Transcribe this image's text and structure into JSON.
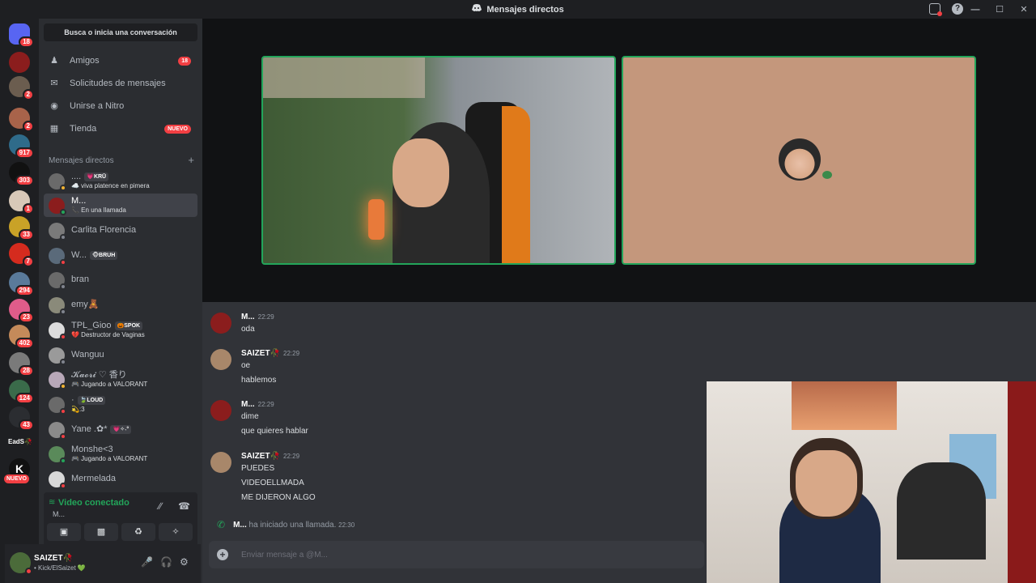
{
  "window": {
    "title": "Mensajes directos"
  },
  "rail": {
    "servers": [
      {
        "badge": "18",
        "color": "#5865f2"
      },
      {
        "badge": "",
        "color": "#8b1d1d"
      },
      {
        "badge": "2",
        "color": "#6b5d4f"
      },
      {
        "badge": "2",
        "color": "#a8634a"
      },
      {
        "badge": "917",
        "color": "#2f6b8a"
      },
      {
        "badge": "303",
        "color": "#111111"
      },
      {
        "badge": "1",
        "color": "#d8c8b8"
      },
      {
        "badge": "33",
        "color": "#c9a227"
      },
      {
        "badge": "7",
        "color": "#d52b1e"
      },
      {
        "badge": "294",
        "color": "#5a7a9a"
      },
      {
        "badge": "23",
        "color": "#e05c8a"
      },
      {
        "badge": "402",
        "color": "#c48a5a"
      },
      {
        "badge": "28",
        "color": "#7a7a7a"
      },
      {
        "badge": "124",
        "color": "#3a6b4a"
      },
      {
        "badge": "43",
        "color": "#2b2d31"
      }
    ],
    "folder_label": "EadS🥀",
    "new_label": "NUEVO"
  },
  "sidebar": {
    "search_label": "Busca o inicia una conversación",
    "nav": [
      {
        "label": "Amigos",
        "icon": "friends-icon",
        "pill": "18"
      },
      {
        "label": "Solicitudes de mensajes",
        "icon": "mail-icon",
        "pill": ""
      },
      {
        "label": "Unirse a Nitro",
        "icon": "nitro-icon",
        "pill": ""
      },
      {
        "label": "Tienda",
        "icon": "shop-icon",
        "pill": "NUEVO"
      }
    ],
    "dm_header": "Mensajes directos",
    "dm_add": "+",
    "dms": [
      {
        "name": "....",
        "tag": "💗KRŪ",
        "sub": "☁️ viva platence en pimera",
        "color": "#6a6a6a",
        "status": "#f0b232"
      },
      {
        "name": "M...",
        "tag": "",
        "sub": "📞 En una llamada",
        "color": "#8b1d1d",
        "status": "#23a55a",
        "active": true
      },
      {
        "name": "Carlita Florencia",
        "tag": "",
        "sub": "",
        "color": "#7a7a7a",
        "status": "#80848e"
      },
      {
        "name": "W...",
        "tag": "🐵BRUH",
        "sub": "",
        "color": "#5a6a7a",
        "status": "#f23f43"
      },
      {
        "name": "bran",
        "tag": "",
        "sub": "",
        "color": "#6a6a6a",
        "status": "#80848e"
      },
      {
        "name": "emy🧸",
        "tag": "",
        "sub": "",
        "color": "#8a8a7a",
        "status": "#80848e"
      },
      {
        "name": "TPL_Gioo",
        "tag": "🎃SPOK",
        "sub": "💔 Destructor de Vaginas",
        "color": "#dcdcdc",
        "status": "#f23f43"
      },
      {
        "name": "Wanguu",
        "tag": "",
        "sub": "",
        "color": "#9a9a9a",
        "status": "#80848e"
      },
      {
        "name": "𝓚𝓪𝓸𝓻𝓲 ♡ 香り",
        "tag": "",
        "sub": "🎮 Jugando a VALORANT",
        "color": "#b8a8b8",
        "status": "#f0b232"
      },
      {
        "name": "·",
        "tag": "🍃LOUD",
        "sub": "💫:3",
        "color": "#6a6a6a",
        "status": "#f23f43"
      },
      {
        "name": "Yane .✿*",
        "tag": "💗✧˖°",
        "sub": "",
        "color": "#8a8a8a",
        "status": "#f23f43"
      },
      {
        "name": "Monshe<3",
        "tag": "",
        "sub": "🎮 Jugando a VALORANT",
        "color": "#5a8a5a",
        "status": "#23a55a"
      },
      {
        "name": "Mermelada",
        "tag": "",
        "sub": "",
        "color": "#d8d8d8",
        "status": "#f23f43"
      }
    ]
  },
  "voice": {
    "status": "Video conectado",
    "channel": "M..."
  },
  "user": {
    "name": "SAIZET🥀",
    "status": "• Kick/ElSaizet 💚"
  },
  "chat": {
    "messages": [
      {
        "author": "M...",
        "time": "22:29",
        "lines": [
          "oda"
        ],
        "color": "#8b1d1d"
      },
      {
        "author": "SAIZET🥀",
        "time": "22:29",
        "lines": [
          "oe",
          "hablemos"
        ],
        "color": "#a8876a"
      },
      {
        "author": "M...",
        "time": "22:29",
        "lines": [
          "dime",
          "que quieres hablar"
        ],
        "color": "#8b1d1d"
      },
      {
        "author": "SAIZET🥀",
        "time": "22:29",
        "lines": [
          "PUEDES",
          "VIDEOELLMADA",
          "ME DIJERON ALGO"
        ],
        "color": "#a8876a"
      }
    ],
    "call": {
      "author": "M...",
      "text": "ha iniciado una llamada.",
      "time": "22:30"
    },
    "composer_placeholder": "Enviar mensaje a @M..."
  },
  "colors": {
    "accent_green": "#23a55a",
    "danger": "#f23f43",
    "blurple": "#5865f2"
  }
}
